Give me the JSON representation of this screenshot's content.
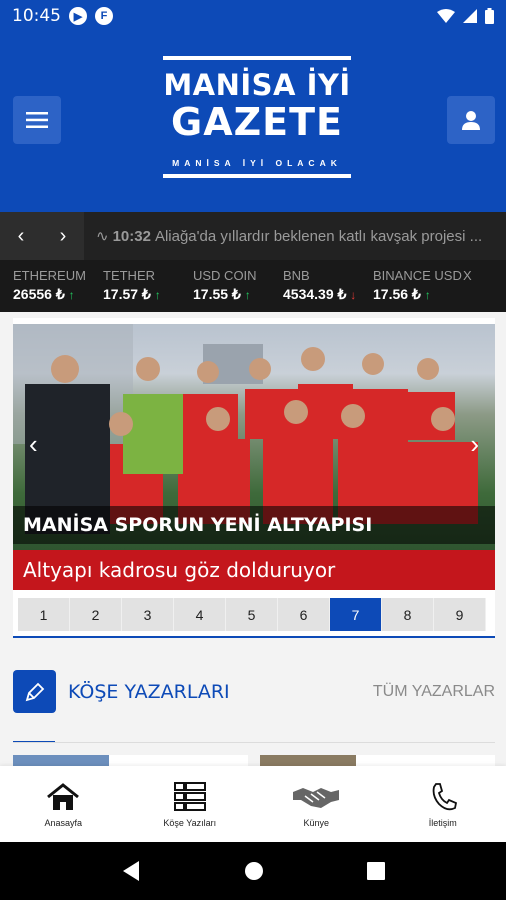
{
  "status_bar": {
    "time": "10:45"
  },
  "header": {
    "logo": {
      "line1": "MANİSA İYİ",
      "line2": "GAZETE",
      "tagline": "MANİSA İYİ OLACAK"
    }
  },
  "ticker": {
    "time": "10:32",
    "text": "Aliağa'da yıllardır beklenen katlı kavşak projesi ..."
  },
  "crypto": [
    {
      "name": "ETHEREUM",
      "value": "26556 ₺",
      "trend": "up"
    },
    {
      "name": "TETHER",
      "value": "17.57 ₺",
      "trend": "up"
    },
    {
      "name": "USD COIN",
      "value": "17.55 ₺",
      "trend": "up"
    },
    {
      "name": "BNB",
      "value": "4534.39 ₺",
      "trend": "down"
    },
    {
      "name": "BINANCE USD",
      "value": "17.56 ₺",
      "trend": "up"
    },
    {
      "name": "X",
      "value": "",
      "trend": ""
    }
  ],
  "slider": {
    "headline": "MANİSA SPORUN YENİ ALTYAPISI",
    "subline": "Altyapı kadrosu göz dolduruyor",
    "pages": [
      "1",
      "2",
      "3",
      "4",
      "5",
      "6",
      "7",
      "8",
      "9"
    ],
    "active_page": "7"
  },
  "columnists": {
    "title": "KÖŞE YAZARLARI",
    "all_link": "TÜM YAZARLAR"
  },
  "bottom_nav": [
    {
      "label": "Anasayfa",
      "icon": "home-icon"
    },
    {
      "label": "Köşe Yazıları",
      "icon": "grid-list-icon"
    },
    {
      "label": "Künye",
      "icon": "handshake-icon"
    },
    {
      "label": "İletişim",
      "icon": "phone-icon"
    }
  ],
  "colors": {
    "brand_blue": "#0d4ab7",
    "accent_red": "#c4161c",
    "ticker_bg": "#222222"
  }
}
